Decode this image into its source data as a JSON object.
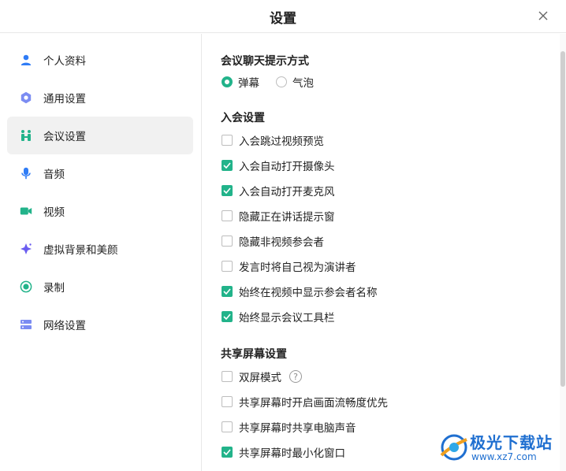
{
  "window": {
    "title": "设置"
  },
  "colors": {
    "accent": "#22b38a",
    "icon_blue": "#2f7cf6",
    "watermark_blue": "#1f6fd0"
  },
  "sidebar": {
    "items": [
      {
        "label": "个人资料",
        "icon": "user-icon",
        "active": false
      },
      {
        "label": "通用设置",
        "icon": "gear-icon",
        "active": false
      },
      {
        "label": "会议设置",
        "icon": "meeting-people-icon",
        "active": true
      },
      {
        "label": "音频",
        "icon": "microphone-icon",
        "active": false
      },
      {
        "label": "视频",
        "icon": "video-camera-icon",
        "active": false
      },
      {
        "label": "虚拟背景和美颜",
        "icon": "sparkle-icon",
        "active": false
      },
      {
        "label": "录制",
        "icon": "record-icon",
        "active": false
      },
      {
        "label": "网络设置",
        "icon": "network-icon",
        "active": false
      }
    ]
  },
  "chat_prompt": {
    "title": "会议聊天提示方式",
    "options": [
      {
        "label": "弹幕",
        "selected": true
      },
      {
        "label": "气泡",
        "selected": false
      }
    ]
  },
  "join_settings": {
    "title": "入会设置",
    "options": [
      {
        "label": "入会跳过视频预览",
        "checked": false
      },
      {
        "label": "入会自动打开摄像头",
        "checked": true
      },
      {
        "label": "入会自动打开麦克风",
        "checked": true
      },
      {
        "label": "隐藏正在讲话提示窗",
        "checked": false
      },
      {
        "label": "隐藏非视频参会者",
        "checked": false
      },
      {
        "label": "发言时将自己视为演讲者",
        "checked": false
      },
      {
        "label": "始终在视频中显示参会者名称",
        "checked": true
      },
      {
        "label": "始终显示会议工具栏",
        "checked": true
      }
    ]
  },
  "share_settings": {
    "title": "共享屏幕设置",
    "help_glyph": "?",
    "options": [
      {
        "label": "双屏模式",
        "checked": false
      },
      {
        "label": "共享屏幕时开启画面流畅度优先",
        "checked": false
      },
      {
        "label": "共享屏幕时共享电脑声音",
        "checked": false
      },
      {
        "label": "共享屏幕时最小化窗口",
        "checked": true
      }
    ]
  },
  "watermark": {
    "text": "极光下载站",
    "url": "www.xz7.com"
  }
}
